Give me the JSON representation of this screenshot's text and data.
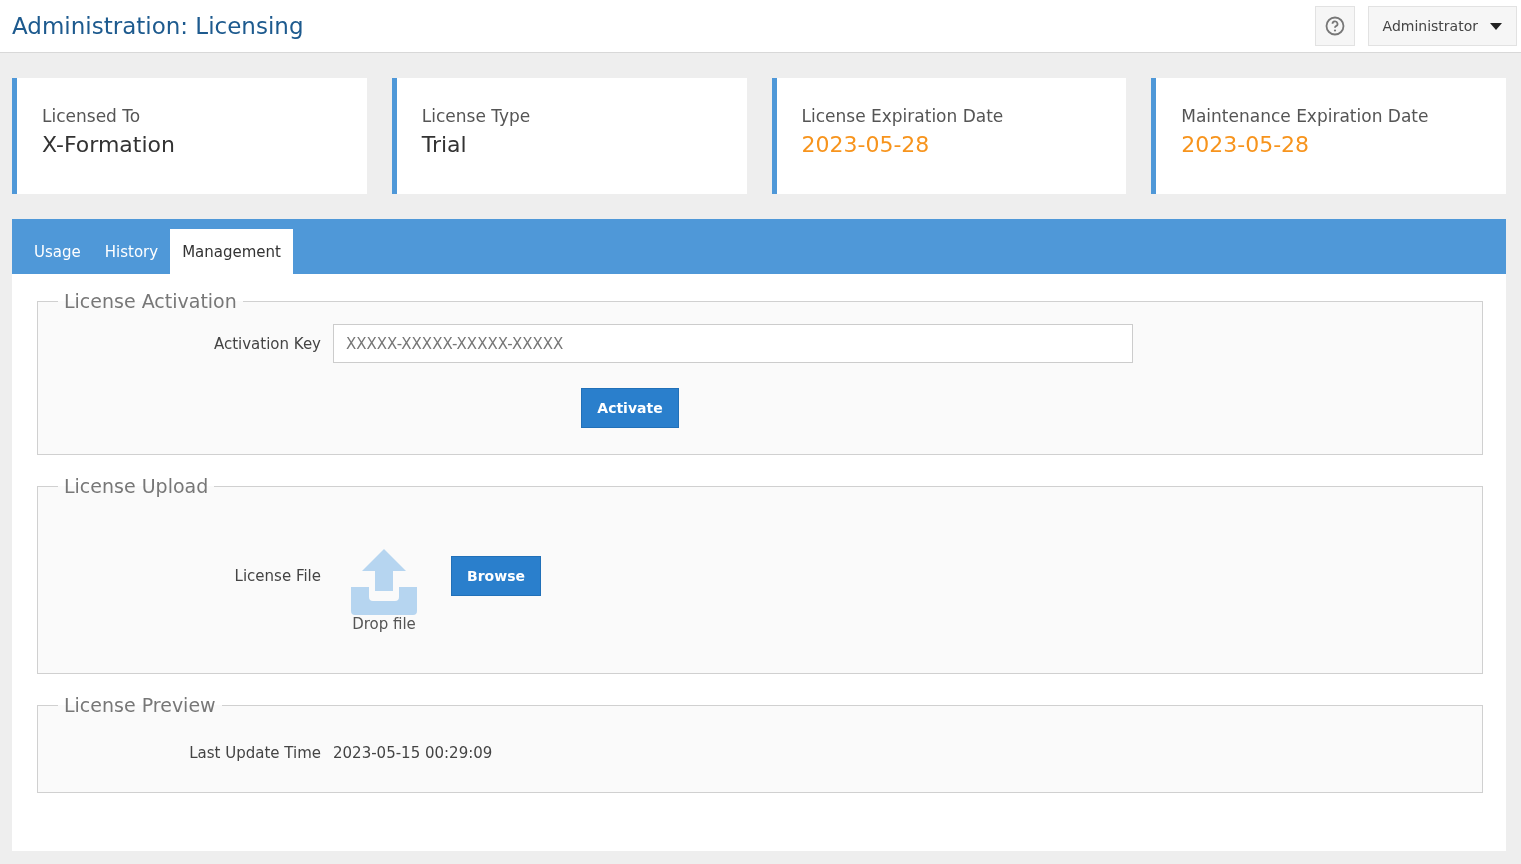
{
  "header": {
    "title": "Administration: Licensing",
    "user_menu": "Administrator"
  },
  "cards": [
    {
      "label": "Licensed To",
      "value": "X-Formation",
      "kind": "text"
    },
    {
      "label": "License Type",
      "value": "Trial",
      "kind": "text"
    },
    {
      "label": "License Expiration Date",
      "value": "2023-05-28",
      "kind": "date"
    },
    {
      "label": "Maintenance Expiration Date",
      "value": "2023-05-28",
      "kind": "date"
    }
  ],
  "tabs": [
    {
      "label": "Usage",
      "selected": false
    },
    {
      "label": "History",
      "selected": false
    },
    {
      "label": "Management",
      "selected": true
    }
  ],
  "activation": {
    "legend": "License Activation",
    "label": "Activation Key",
    "placeholder": "XXXXX-XXXXX-XXXXX-XXXXX",
    "button": "Activate"
  },
  "upload": {
    "legend": "License Upload",
    "label": "License File",
    "drop_text": "Drop file",
    "button": "Browse"
  },
  "preview": {
    "legend": "License Preview",
    "label": "Last Update Time",
    "value": "2023-05-15 00:29:09"
  }
}
